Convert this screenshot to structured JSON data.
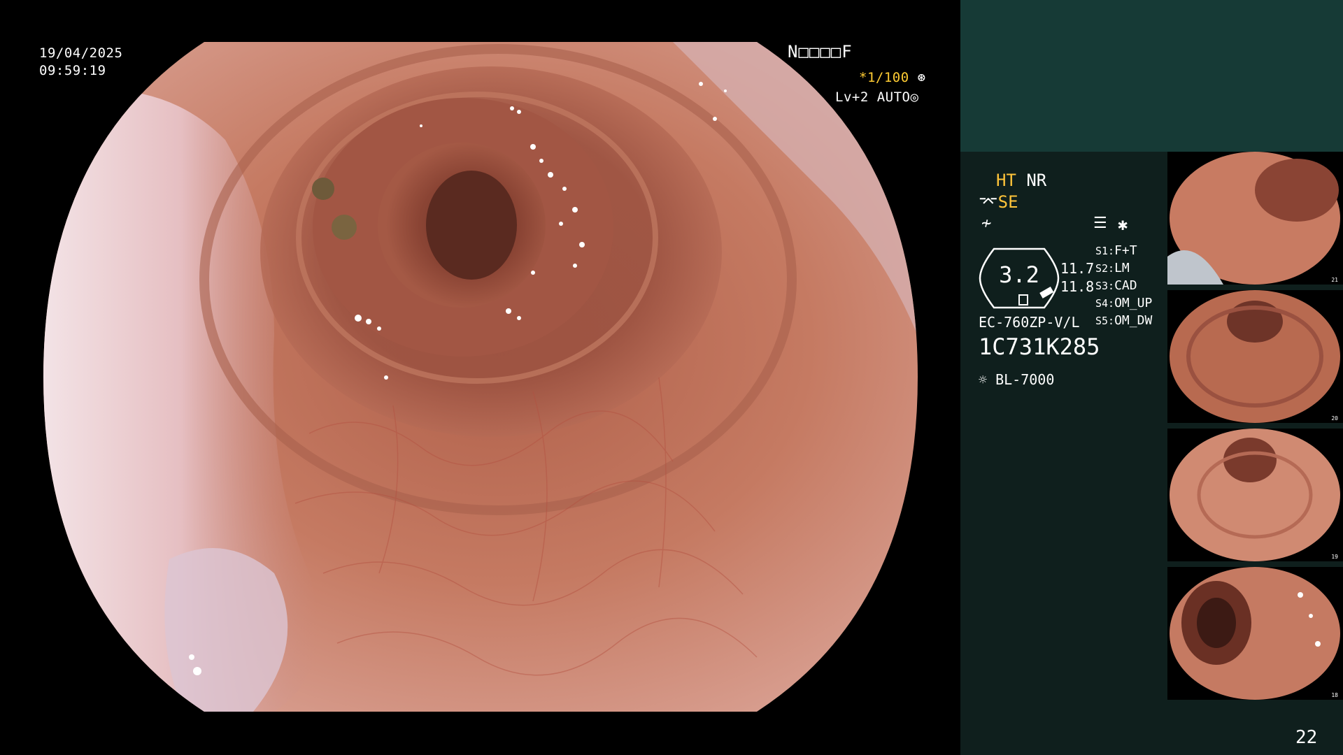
{
  "osd": {
    "date": "19/04/2025",
    "time": "09:59:19",
    "patient_code": "N□□□□F",
    "shutter": "*1/100",
    "shutter_icon": "⊛",
    "level": "Lv+2 AUTO",
    "level_icon": "◎"
  },
  "panel": {
    "ht": "HT",
    "nr": "NR",
    "se": "SE",
    "gauge_value": "3.2",
    "value_1": "11.7",
    "value_2": "11.8",
    "switches": [
      {
        "key": "S1:",
        "value": "F+T"
      },
      {
        "key": "S2:",
        "value": "LM"
      },
      {
        "key": "S3:",
        "value": "CAD"
      },
      {
        "key": "S4:",
        "value": "OM_UP"
      },
      {
        "key": "S5:",
        "value": "OM_DW"
      }
    ],
    "scope_model": "EC-760ZP-V/L",
    "scope_serial": "1C731K285",
    "light_source": "BL-7000",
    "page_number": "22"
  },
  "thumbnail_labels": [
    "21",
    "20",
    "19",
    "18"
  ],
  "colors": {
    "panel_bg": "#0f1f1d",
    "panel_top_bg": "#163a36",
    "accent_yellow": "#ffc43a",
    "mucosa": "#c07258"
  }
}
